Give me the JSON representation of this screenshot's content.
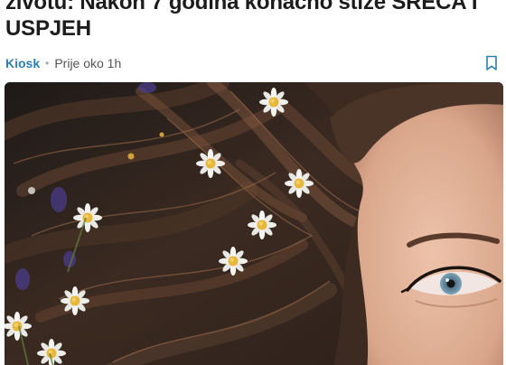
{
  "article": {
    "title_line1": "životu: Nakon 7 godina konačno stiže SREĆA I",
    "title_line2": "USPJEH",
    "source": "Kiosk",
    "separator": "•",
    "time": "Prije oko 1h"
  },
  "icons": {
    "bookmark": "bookmark-icon"
  },
  "colors": {
    "source_link": "#2f7fb0",
    "title_text": "#1c1c1c",
    "hair": "#3a2a20",
    "skin": "#e2b49a"
  }
}
